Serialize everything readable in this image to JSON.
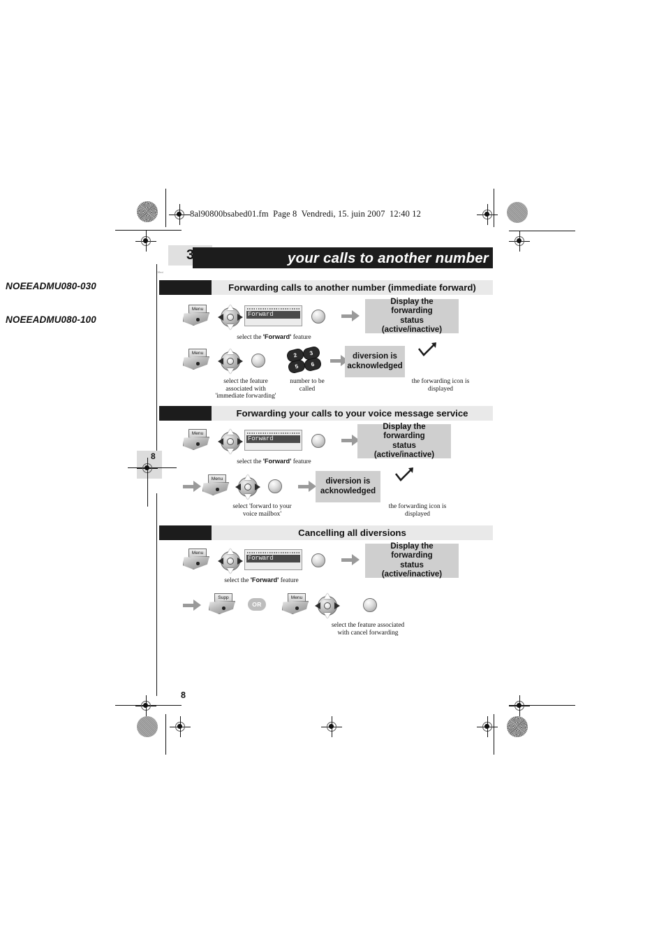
{
  "document": {
    "fm_header": "8al90800bsabed01.fm  Page 8  Vendredi, 15. juin 2007  12:40 12",
    "chapter_number": "3",
    "chapter_title": "your calls to another number",
    "page_tab_number": "8",
    "folio": "8",
    "tiny_mark": "ORed"
  },
  "margin_codes": [
    {
      "label": "NOEEADMU080-030"
    },
    {
      "label": "NOEEADMU080-100"
    }
  ],
  "sections": [
    {
      "id": "immediate-forward",
      "title": "Forwarding calls to another number (immediate forward)",
      "rows": [
        {
          "steps": [
            {
              "type": "key",
              "label": "Menu"
            },
            {
              "type": "navigator"
            },
            {
              "type": "lcd",
              "text": "Forward"
            },
            {
              "type": "round-key"
            },
            {
              "type": "arrow"
            },
            {
              "type": "callout",
              "text": "Display the forwarding status (active/inactive)"
            }
          ],
          "captions": [
            {
              "text": "select the 'Forward' feature",
              "bold_part": "Forward"
            }
          ]
        },
        {
          "steps": [
            {
              "type": "key",
              "label": "Menu"
            },
            {
              "type": "navigator"
            },
            {
              "type": "round-key"
            },
            {
              "type": "keypad",
              "digits": [
                "2",
                "3",
                "5",
                "6"
              ]
            },
            {
              "type": "arrow"
            },
            {
              "type": "callout",
              "text": "diversion is acknowledged"
            },
            {
              "type": "tick-icon"
            }
          ],
          "captions": [
            {
              "text": "select the feature associated with 'immediate forwarding'"
            },
            {
              "text": "number to be called"
            },
            {
              "text": "the forwarding icon is displayed"
            }
          ]
        }
      ]
    },
    {
      "id": "voice-message-service",
      "title": "Forwarding your calls to your voice message service",
      "rows": [
        {
          "steps": [
            {
              "type": "key",
              "label": "Menu"
            },
            {
              "type": "navigator"
            },
            {
              "type": "lcd",
              "text": "Forward"
            },
            {
              "type": "round-key"
            },
            {
              "type": "arrow"
            },
            {
              "type": "callout",
              "text": "Display the forwarding status (active/inactive)"
            }
          ],
          "captions": [
            {
              "text": "select the 'Forward' feature",
              "bold_part": "Forward"
            }
          ]
        },
        {
          "steps": [
            {
              "type": "arrow"
            },
            {
              "type": "key",
              "label": "Menu"
            },
            {
              "type": "navigator"
            },
            {
              "type": "round-key"
            },
            {
              "type": "arrow"
            },
            {
              "type": "callout",
              "text": "diversion is acknowledged"
            },
            {
              "type": "tick-icon"
            }
          ],
          "captions": [
            {
              "text": "select 'forward to your voice mailbox'"
            },
            {
              "text": "the forwarding icon is displayed"
            }
          ]
        }
      ]
    },
    {
      "id": "cancel-diversions",
      "title": "Cancelling all diversions",
      "rows": [
        {
          "steps": [
            {
              "type": "key",
              "label": "Menu"
            },
            {
              "type": "navigator"
            },
            {
              "type": "lcd",
              "text": "Forward"
            },
            {
              "type": "round-key"
            },
            {
              "type": "arrow"
            },
            {
              "type": "callout",
              "text": "Display the forwarding status (active/inactive)"
            }
          ],
          "captions": [
            {
              "text": "select the 'Forward' feature",
              "bold_part": "Forward"
            }
          ]
        },
        {
          "steps": [
            {
              "type": "arrow"
            },
            {
              "type": "key",
              "label": "Supp"
            },
            {
              "type": "or-badge",
              "label": "OR"
            },
            {
              "type": "key",
              "label": "Menu"
            },
            {
              "type": "navigator"
            },
            {
              "type": "round-key"
            }
          ],
          "captions": [
            {
              "text": "select the feature associated with cancel forwarding"
            }
          ]
        }
      ]
    }
  ],
  "labels": {
    "menu_key": "Menu",
    "supp_key": "Supp",
    "or_badge": "OR",
    "lcd_forward": "Forward",
    "callout_display_status_line1": "Display the forwarding",
    "callout_display_status_line2": "status (active/inactive)",
    "callout_diversion_line1": "diversion is",
    "callout_diversion_line2": "acknowledged",
    "cap_select_forward_pre": "select the ",
    "cap_select_forward_bold": "'Forward'",
    "cap_select_forward_post": " feature",
    "cap_sel_feature_l1": "select the feature",
    "cap_sel_feature_l2": "associated with",
    "cap_sel_feature_l3": "'immediate forwarding'",
    "cap_number_l1": "number to be",
    "cap_number_l2": "called",
    "cap_icon_l1": "the forwarding icon is",
    "cap_icon_l2": "displayed",
    "cap_vmail_l1": "select 'forward to your",
    "cap_vmail_l2": "voice mailbox'",
    "cap_cancel_l1": "select the feature associated",
    "cap_cancel_l2": "with cancel forwarding",
    "digit2": "2",
    "digit3": "3",
    "digit5": "5",
    "digit6": "6"
  },
  "colors": {
    "banner_black": "#1c1c1c",
    "chapter_num_grey": "#e0e0e0",
    "section_grey": "#e9e9e9",
    "callout_grey": "#cfcfcf",
    "arrow_grey": "#9a9a9a",
    "page_tab_grey": "#dcdcdc"
  }
}
